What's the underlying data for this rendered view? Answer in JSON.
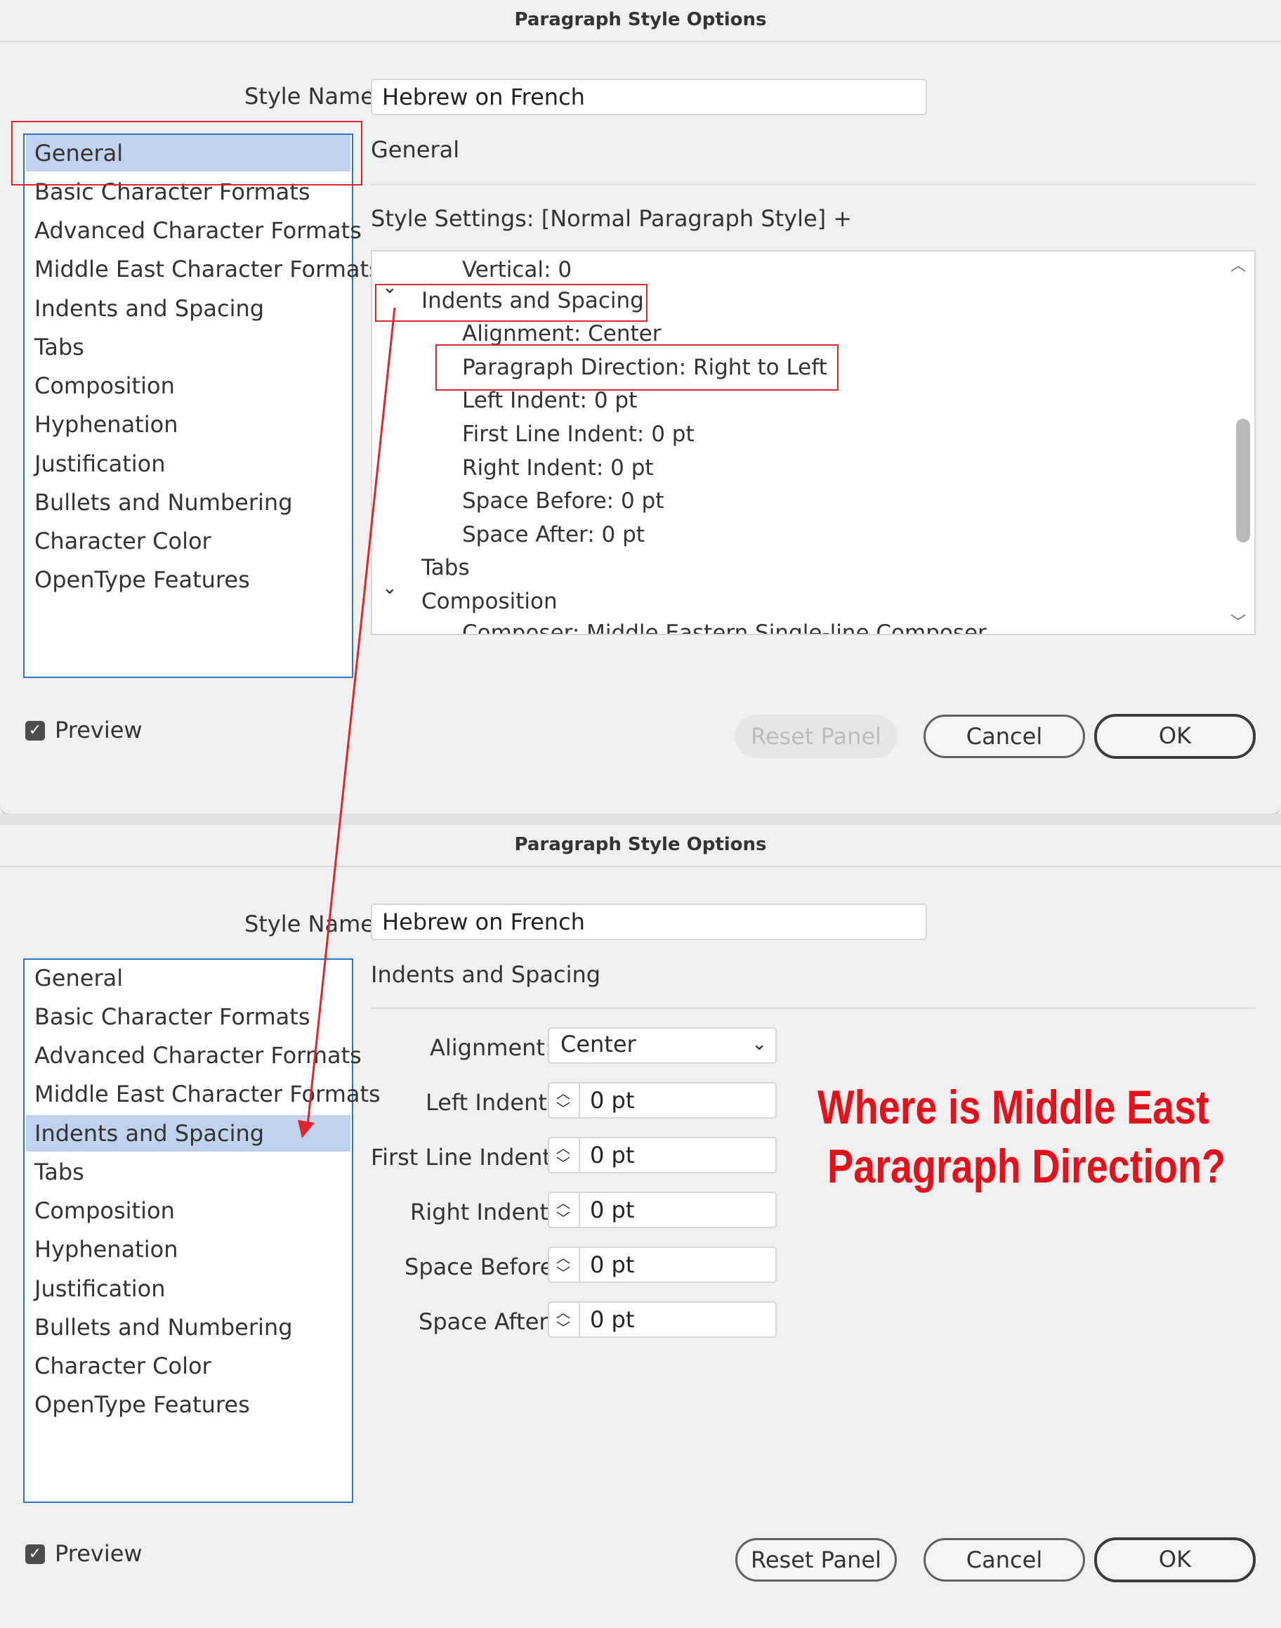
{
  "top_dialog": {
    "title": "Paragraph Style Options",
    "style_name_label": "Style Name:",
    "style_name_value": "Hebrew on French",
    "categories": [
      {
        "label": "General",
        "selected": true
      },
      {
        "label": "Basic Character Formats"
      },
      {
        "label": "Advanced Character Formats"
      },
      {
        "label": "Middle East Character Formats"
      },
      {
        "label": "Indents and Spacing"
      },
      {
        "label": "Tabs"
      },
      {
        "label": "Composition"
      },
      {
        "label": "Hyphenation"
      },
      {
        "label": "Justification"
      },
      {
        "label": "Bullets and Numbering"
      },
      {
        "label": "Character Color"
      },
      {
        "label": "OpenType Features"
      }
    ],
    "section_title": "General",
    "style_settings": "Style Settings: [Normal Paragraph Style] +",
    "tree": {
      "vertical": "Vertical: 0",
      "indents_group": "Indents and Spacing",
      "alignment": "Alignment: Center",
      "paragraph_direction": "Paragraph Direction: Right to Left",
      "left_indent": "Left Indent: 0 pt",
      "first_line_indent": "First Line Indent: 0 pt",
      "right_indent": "Right Indent: 0 pt",
      "space_before": "Space Before: 0 pt",
      "space_after": "Space After: 0 pt",
      "tabs": "Tabs",
      "composition_group": "Composition",
      "composer": "Composer: Middle Eastern Single-line Composer"
    },
    "preview_label": "Preview",
    "preview_checked": true,
    "reset_label": "Reset Panel",
    "reset_enabled": false,
    "cancel_label": "Cancel",
    "ok_label": "OK"
  },
  "bottom_dialog": {
    "title": "Paragraph Style Options",
    "style_name_label": "Style Name:",
    "style_name_value": "Hebrew on French",
    "categories": [
      {
        "label": "General"
      },
      {
        "label": "Basic Character Formats"
      },
      {
        "label": "Advanced Character Formats"
      },
      {
        "label": "Middle East Character Formats"
      },
      {
        "label": "Indents and Spacing",
        "selected": true
      },
      {
        "label": "Tabs"
      },
      {
        "label": "Composition"
      },
      {
        "label": "Hyphenation"
      },
      {
        "label": "Justification"
      },
      {
        "label": "Bullets and Numbering"
      },
      {
        "label": "Character Color"
      },
      {
        "label": "OpenType Features"
      }
    ],
    "section_title": "Indents and Spacing",
    "alignment_label": "Alignment:",
    "alignment_value": "Center",
    "left_indent_label": "Left Indent:",
    "left_indent_value": "0 pt",
    "first_line_indent_label": "First Line Indent:",
    "first_line_indent_value": "0 pt",
    "right_indent_label": "Right Indent:",
    "right_indent_value": "0 pt",
    "space_before_label": "Space Before:",
    "space_before_value": "0 pt",
    "space_after_label": "Space After:",
    "space_after_value": "0 pt",
    "preview_label": "Preview",
    "preview_checked": true,
    "reset_label": "Reset Panel",
    "cancel_label": "Cancel",
    "ok_label": "OK"
  },
  "annotation": {
    "line1": "Where is Middle East",
    "line2": "Paragraph Direction?",
    "color": "#e3121a"
  }
}
